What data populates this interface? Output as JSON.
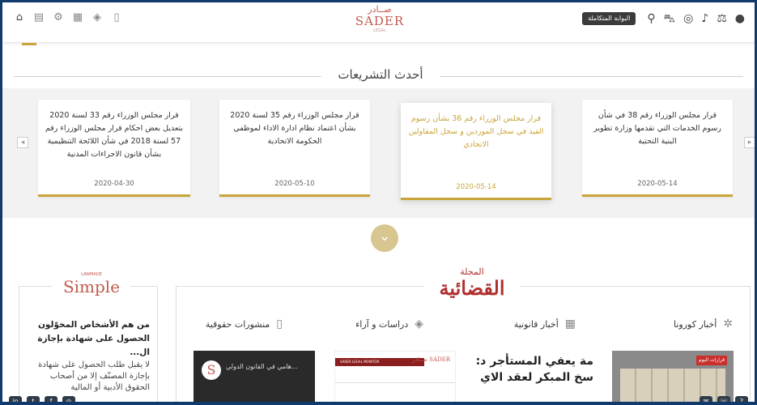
{
  "header": {
    "logo_ar": "صــادر",
    "logo_en": "SADER",
    "logo_sub": "LEGAL",
    "portal_label": "البوابة المتكاملة",
    "left_icons": [
      "home-icon",
      "document-icon",
      "gear-icon",
      "news-icon",
      "graduation-icon",
      "book-icon"
    ],
    "right_icons": [
      "search-icon",
      "cart-icon",
      "globe-icon",
      "bell-icon",
      "scales-icon",
      "user-icon"
    ]
  },
  "legislation": {
    "title": "أحدث التشريعات",
    "cards": [
      {
        "text": "قرار مجلس الوزراء رقم 33 لسنة 2020 بتعديل بعض احكام قرار مجلس الوزراء رقم 57 لسنة 2018 في شأن اللائحة التنظيمية بشأن قانون الاجراءات المدنية",
        "date": "2020-04-30"
      },
      {
        "text": "قرار مجلس الوزراء رقم 35 لسنة 2020 بشأن اعتماد نظام ادارة الاداء لموظفي الحكومة الاتحادية",
        "date": "2020-05-10"
      },
      {
        "text": "قرار مجلس الوزراء رقم 36 بشأن رسوم القيد في سجل الموردين و سجل المقاولين الاتحادي",
        "date": "2020-05-14"
      },
      {
        "text": "قرار مجلس الوزراء رقم 38 في شأن رسوم الخدمات التي تقدمها وزارة تطوير البنية التحتية",
        "date": "2020-05-14"
      }
    ]
  },
  "simple": {
    "logo_small": "LAWMADE",
    "logo_word": "Simple",
    "title": "من هم الأشخاص المخوّلون الحصول على شهادة بإجازة ال...",
    "body": "لا يقبل طلب الحصول على شهادة بإجازة المصنّف إلا من أصحاب الحقوق الأدبية أو المالية"
  },
  "magazine": {
    "logo_top": "المجلة",
    "logo_main": "القضائية",
    "tabs": [
      {
        "label": "أخبار كورونا",
        "icon": "virus-icon"
      },
      {
        "label": "أخبار قانونية",
        "icon": "news-icon"
      },
      {
        "label": "دراسات و آراء",
        "icon": "graduation-icon"
      },
      {
        "label": "منشورات حقوقية",
        "icon": "book-icon"
      }
    ],
    "thumb1_caption": "...هامي في القانون الدولي",
    "thumb2_band": "SADER LEGAL MONITOR",
    "thumb2_logo": "صــادر SADER",
    "thumb3_line1": "مة يعفي المستأجر د:",
    "thumb3_line2": "سخ المبكر لعقد الاي",
    "thumb4_tag": "قرارات اليوم"
  }
}
